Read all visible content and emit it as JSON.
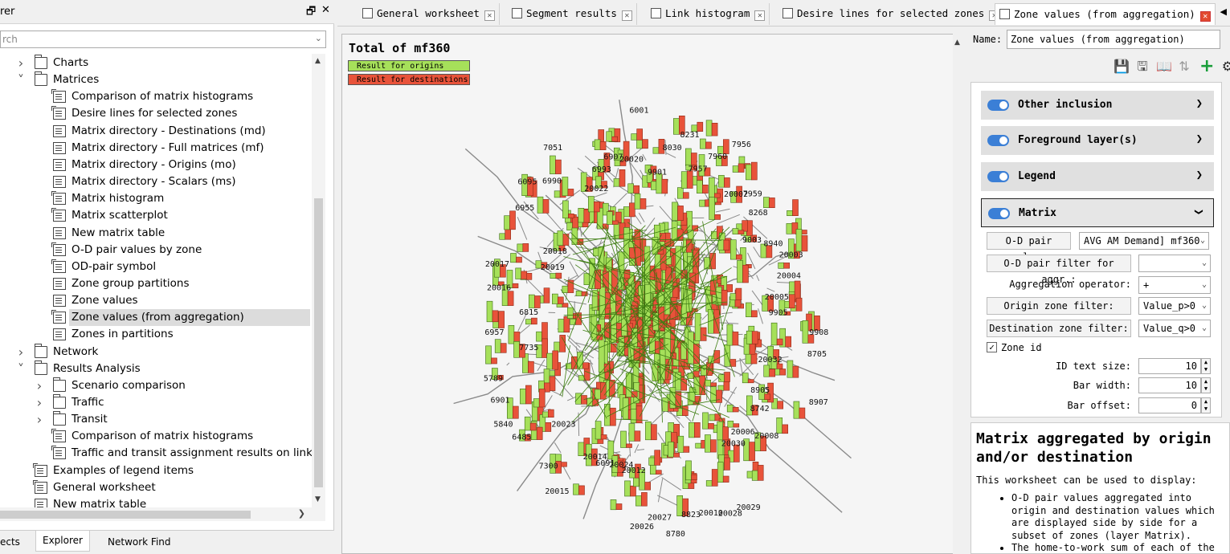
{
  "explorer": {
    "title": "rer",
    "float_glyph": "🗗",
    "close_glyph": "✕",
    "search_placeholder": "rch",
    "items": [
      {
        "label": "Charts",
        "kind": "folder",
        "level": 1,
        "state": "collapsed"
      },
      {
        "label": "Matrices",
        "kind": "folder",
        "level": 1,
        "state": "expanded"
      },
      {
        "label": "Comparison of matrix histograms",
        "kind": "worksheet",
        "level": 2
      },
      {
        "label": "Desire lines for selected zones",
        "kind": "worksheet",
        "level": 2
      },
      {
        "label": "Matrix directory - Destinations (md)",
        "kind": "table",
        "level": 2
      },
      {
        "label": "Matrix directory - Full matrices (mf)",
        "kind": "table",
        "level": 2
      },
      {
        "label": "Matrix directory - Origins (mo)",
        "kind": "table",
        "level": 2
      },
      {
        "label": "Matrix directory - Scalars (ms)",
        "kind": "table",
        "level": 2
      },
      {
        "label": "Matrix histogram",
        "kind": "worksheet",
        "level": 2
      },
      {
        "label": "Matrix scatterplot",
        "kind": "worksheet",
        "level": 2
      },
      {
        "label": "New matrix table",
        "kind": "table",
        "level": 2
      },
      {
        "label": "O-D pair values by zone",
        "kind": "worksheet",
        "level": 2
      },
      {
        "label": "OD-pair symbol",
        "kind": "worksheet",
        "level": 2
      },
      {
        "label": "Zone group partitions",
        "kind": "table",
        "level": 2
      },
      {
        "label": "Zone values",
        "kind": "table",
        "level": 2
      },
      {
        "label": "Zone values (from aggregation)",
        "kind": "worksheet",
        "level": 2,
        "selected": true
      },
      {
        "label": "Zones in partitions",
        "kind": "table",
        "level": 2
      },
      {
        "label": "Network",
        "kind": "folder",
        "level": 1,
        "state": "collapsed"
      },
      {
        "label": "Results Analysis",
        "kind": "folder",
        "level": 1,
        "state": "expanded"
      },
      {
        "label": "Scenario comparison",
        "kind": "folder",
        "level": 2,
        "state": "collapsed"
      },
      {
        "label": "Traffic",
        "kind": "folder",
        "level": 2,
        "state": "collapsed"
      },
      {
        "label": "Transit",
        "kind": "folder",
        "level": 2,
        "state": "collapsed"
      },
      {
        "label": "Comparison of matrix histograms",
        "kind": "worksheet",
        "level": 2
      },
      {
        "label": "Traffic and transit assignment results on links",
        "kind": "worksheet",
        "level": 2
      },
      {
        "label": "Examples of legend items",
        "kind": "worksheet",
        "level": 1
      },
      {
        "label": "General worksheet",
        "kind": "worksheet",
        "level": 1
      },
      {
        "label": "New matrix table",
        "kind": "table",
        "level": 1
      }
    ],
    "bottom_tabs": [
      "ects",
      "Explorer",
      "Network Find"
    ]
  },
  "doc_tabs": [
    {
      "label": "General worksheet",
      "active": false
    },
    {
      "label": "Segment results",
      "active": false
    },
    {
      "label": "Link histogram",
      "active": false
    },
    {
      "label": "Desire lines for selected zones",
      "active": false
    },
    {
      "label": "Zone values (from aggregation)",
      "active": true
    }
  ],
  "canvas": {
    "title": "Total of  mf360",
    "legend": [
      {
        "label": "Result for origins",
        "color": "#a6e05a"
      },
      {
        "label": "Result for destinations",
        "color": "#e8533a"
      }
    ],
    "zone_labels": [
      "9901",
      "8030",
      "8231",
      "7957",
      "7960",
      "7956",
      "20002",
      "7959",
      "8268",
      "9003",
      "8940",
      "20003",
      "20004",
      "20005",
      "9905",
      "9908",
      "8705",
      "20032",
      "8907",
      "8905",
      "8742",
      "20008",
      "20006",
      "20030",
      "20029",
      "20028",
      "20010",
      "8823",
      "8780",
      "20027",
      "20026",
      "20012",
      "20024",
      "6091",
      "20014",
      "20015",
      "7300",
      "20023",
      "6485",
      "5840",
      "6901",
      "5789",
      "7735",
      "6957",
      "6815",
      "20016",
      "20017",
      "20019",
      "20018",
      "6955",
      "6095",
      "6990",
      "7051",
      "20022",
      "6993",
      "6907",
      "20020",
      "6001"
    ]
  },
  "props": {
    "name_label": "Name:",
    "name_value": "Zone values (from aggregation)",
    "sections": [
      {
        "title": "Other inclusion",
        "open": false
      },
      {
        "title": "Foreground layer(s)",
        "open": false
      },
      {
        "title": "Legend",
        "open": false
      },
      {
        "title": "Matrix",
        "open": true
      }
    ],
    "matrix_rows": {
      "od_pair_label": "O-D pair value:",
      "od_pair_value": "AVG AM Demand] mf360",
      "filter_label": "O-D pair filter for aggr.:",
      "filter_value": "",
      "agg_label": "Aggregation operator:",
      "agg_value": "+",
      "origin_label": "Origin zone filter:",
      "origin_value": "Value_p>0",
      "dest_label": "Destination zone filter:",
      "dest_value": "Value_q>0",
      "zone_id_label": "Zone id",
      "id_text_label": "ID text size:",
      "id_text_value": "10",
      "bar_width_label": "Bar width:",
      "bar_width_value": "10",
      "bar_offset_label": "Bar offset:",
      "bar_offset_value": "0"
    },
    "help": {
      "title": "Matrix aggregated by origin and/or destination",
      "intro": "This worksheet can be used to display:",
      "bullets": [
        "O-D pair values aggregated into origin and destination values which are displayed side by side for a subset of zones (layer Matrix).",
        "The home-to-work sum of each of the"
      ]
    }
  },
  "colors": {
    "origin": "#a6e05a",
    "destination": "#e8533a",
    "network": "#8a8a8a",
    "toggle": "#3b7fd6"
  }
}
